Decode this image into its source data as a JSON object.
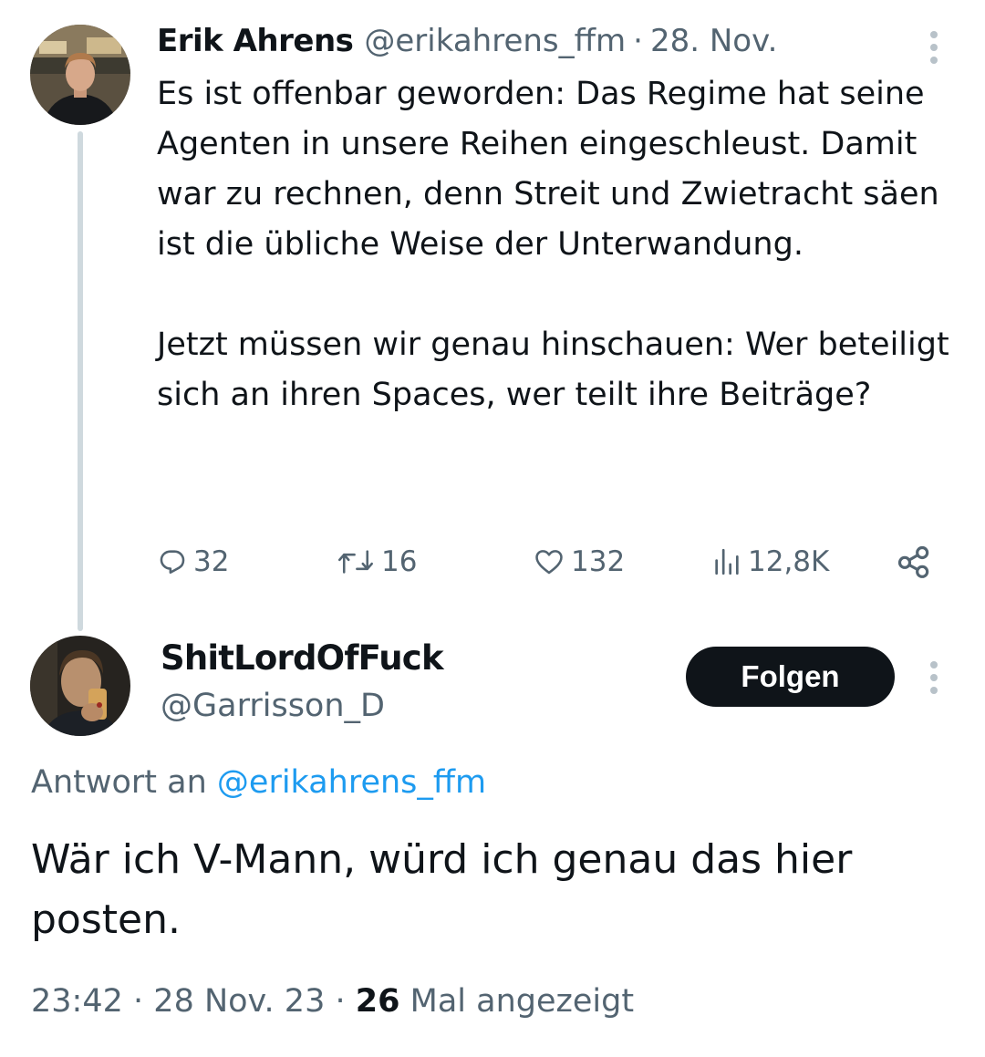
{
  "tweet1": {
    "author_name": "Erik Ahrens",
    "author_handle": "@erikahrens_ffm",
    "separator": "·",
    "date": "28. Nov.",
    "text_p1": "Es ist offenbar geworden: Das Regime hat seine Agenten in unsere Reihen eingeschleust. Damit war zu rechnen, denn Streit und Zwietracht säen ist die übliche Weise der Unterwandung.",
    "text_p2": "Jetzt müssen wir genau hinschauen: Wer beteiligt sich an ihren Spaces, wer teilt ihre Beiträge?",
    "stats": {
      "replies": "32",
      "reposts": "16",
      "likes": "132",
      "views": "12,8K"
    },
    "icons": {
      "reply": "reply-icon",
      "repost": "repost-icon",
      "like": "heart-icon",
      "views": "views-icon",
      "share": "share-icon",
      "more": "more-icon"
    }
  },
  "tweet2": {
    "author_name": "ShitLordOfFuck",
    "author_handle": "@Garrisson_D",
    "follow_label": "Folgen",
    "reply_prefix": "Antwort an",
    "reply_mention": "@erikahrens_ffm",
    "text": "Wär ich V-Mann, würd ich genau das hier posten.",
    "meta": {
      "time": "23:42",
      "sep1": "·",
      "date": "28 Nov. 23",
      "sep2": "·",
      "views_count": "26",
      "views_label": "Mal angezeigt"
    }
  },
  "colors": {
    "text": "#0f1419",
    "secondary": "#536471",
    "link": "#1d9bf0",
    "thread_line": "#cfd9de",
    "button_bg": "#0f1419"
  }
}
